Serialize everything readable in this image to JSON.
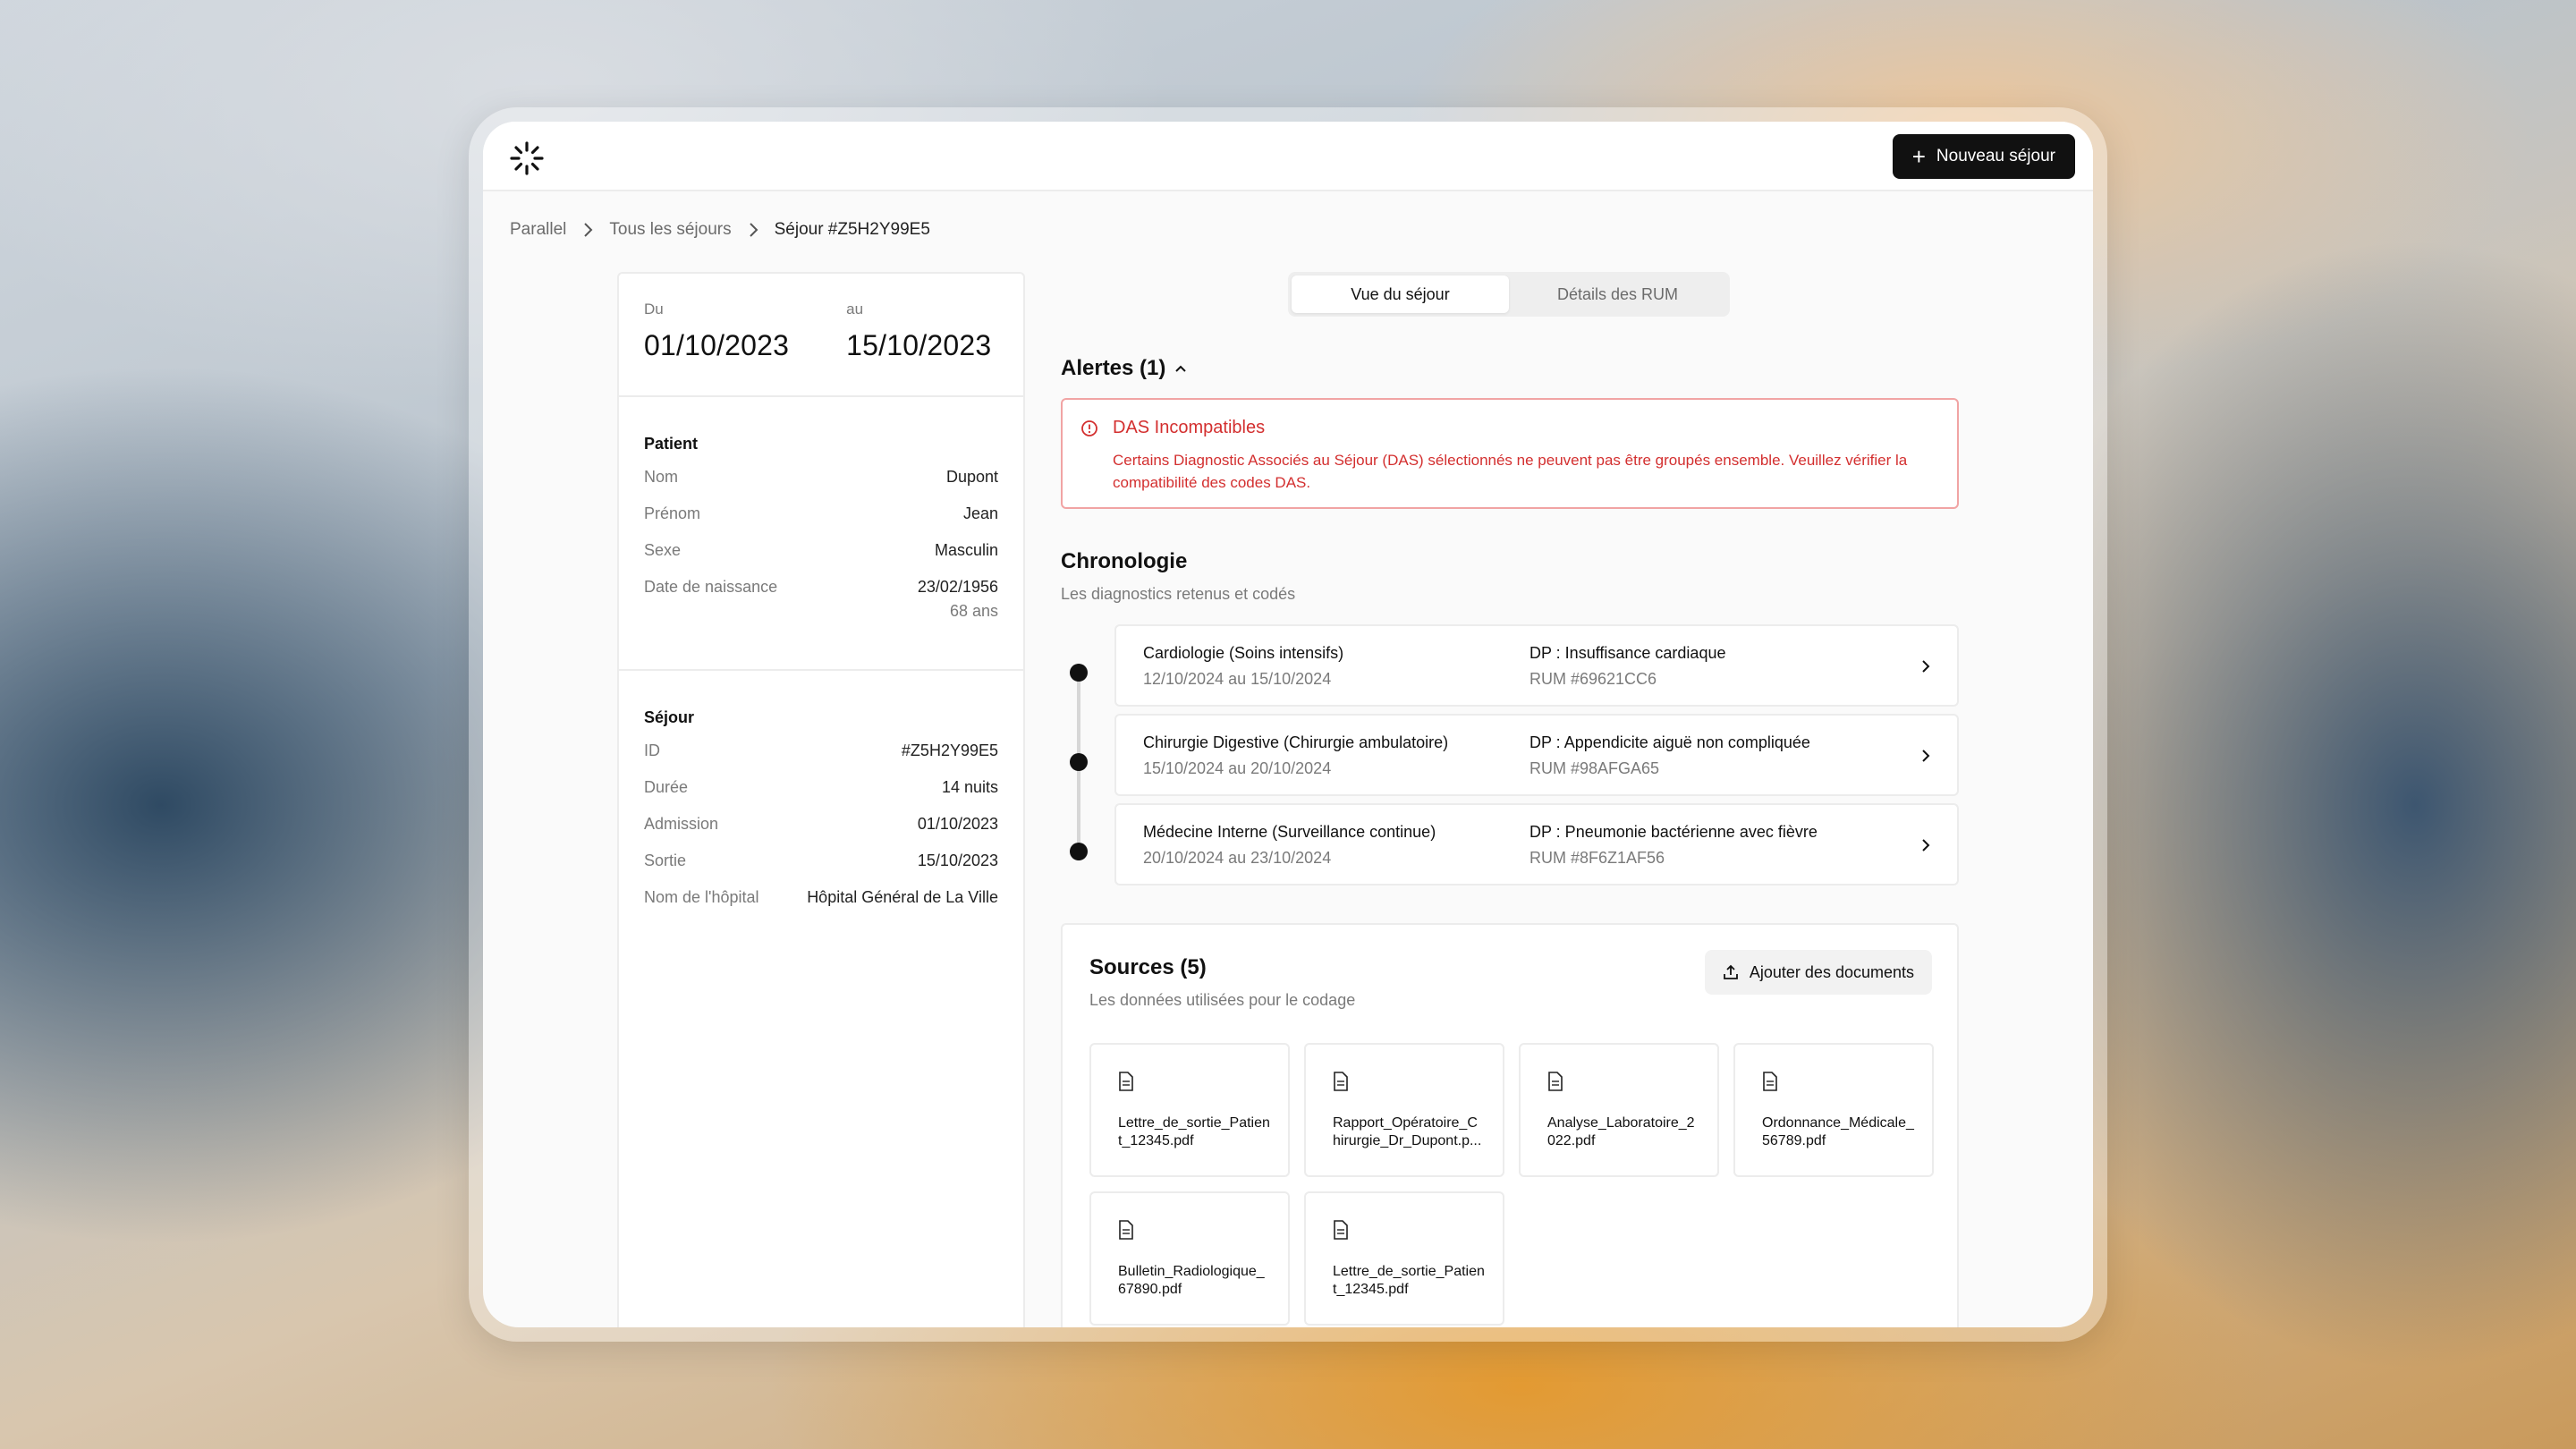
{
  "topbar": {
    "new_button_label": "Nouveau séjour"
  },
  "breadcrumb": {
    "items": [
      "Parallel",
      "Tous les séjours",
      "Séjour #Z5H2Y99E5"
    ]
  },
  "dates": {
    "from_label": "Du",
    "from_value": "01/10/2023",
    "to_label": "au",
    "to_value": "15/10/2023"
  },
  "patient": {
    "title": "Patient",
    "rows": [
      {
        "k": "Nom",
        "v": "Dupont"
      },
      {
        "k": "Prénom",
        "v": "Jean"
      },
      {
        "k": "Sexe",
        "v": "Masculin"
      },
      {
        "k": "Date de naissance",
        "v": "23/02/1956",
        "sub": "68 ans"
      }
    ]
  },
  "sejour": {
    "title": "Séjour",
    "rows": [
      {
        "k": "ID",
        "v": "#Z5H2Y99E5"
      },
      {
        "k": "Durée",
        "v": "14 nuits"
      },
      {
        "k": "Admission",
        "v": "01/10/2023"
      },
      {
        "k": "Sortie",
        "v": "15/10/2023"
      },
      {
        "k": "Nom de l'hôpital",
        "v": "Hôpital Général de La Ville"
      }
    ]
  },
  "tabs": [
    {
      "label": "Vue du séjour"
    },
    {
      "label": "Détails des RUM"
    }
  ],
  "alerts": {
    "heading": "Alertes (1)",
    "items": [
      {
        "title": "DAS Incompatibles",
        "text": "Certains Diagnostic Associés au Séjour (DAS) sélectionnés ne peuvent pas être groupés ensemble. Veuillez vérifier la compatibilité des codes DAS."
      }
    ]
  },
  "chronologie": {
    "title": "Chronologie",
    "subtitle": "Les diagnostics retenus et codés",
    "items": [
      {
        "service": "Cardiologie (Soins intensifs)",
        "dates": "12/10/2024 au 15/10/2024",
        "dp": "DP : Insuffisance cardiaque",
        "rum": "RUM #69621CC6"
      },
      {
        "service": "Chirurgie Digestive (Chirurgie ambulatoire)",
        "dates": "15/10/2024 au 20/10/2024",
        "dp": "DP : Appendicite aiguë non compliquée",
        "rum": "RUM #98AFGA65"
      },
      {
        "service": "Médecine Interne (Surveillance continue)",
        "dates": "20/10/2024 au 23/10/2024",
        "dp": "DP : Pneumonie bactérienne avec fièvre",
        "rum": "RUM #8F6Z1AF56"
      }
    ]
  },
  "sources": {
    "title": "Sources (5)",
    "subtitle": "Les données utilisées pour le codage",
    "add_button_label": "Ajouter des documents",
    "files": [
      "Lettre_de_sortie_Patient_12345.pdf",
      "Rapport_Opératoire_Chirurgie_Dr_Dupont.p...",
      "Analyse_Laboratoire_2022.pdf",
      "Ordonnance_Médicale_56789.pdf",
      "Bulletin_Radiologique_67890.pdf",
      "Lettre_de_sortie_Patient_12345.pdf"
    ]
  },
  "colors": {
    "accent": "#111111",
    "alert": "#d32f2f",
    "alert_border": "#f1a4a4"
  },
  "icons": [
    "logo-icon",
    "plus-icon",
    "chevron-right-icon",
    "chevron-up-icon",
    "alert-circle-icon",
    "upload-icon",
    "file-icon"
  ]
}
